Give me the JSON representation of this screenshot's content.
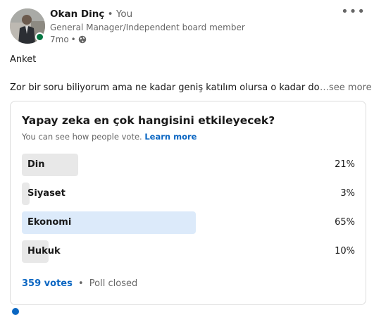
{
  "author": {
    "name": "Okan Dinç",
    "degree": "• You",
    "headline": "General Manager/Independent board member",
    "time": "7mo",
    "visibility_icon": "globe-icon",
    "presence_color": "#057642"
  },
  "post": {
    "line1": "Anket",
    "line2": "Zor bir soru biliyorum ama ne kadar geniş katılım olursa o kadar doğru",
    "see_more": "…see more"
  },
  "poll": {
    "question": "Yapay zeka en çok hangisini etkileyecek?",
    "note": "You can see how people vote.",
    "learn_more": "Learn more",
    "options": [
      {
        "label": "Din",
        "percent_text": "21%",
        "percent": 21,
        "highlight": false
      },
      {
        "label": "Siyaset",
        "percent_text": "3%",
        "percent": 3,
        "highlight": false
      },
      {
        "label": "Ekonomi",
        "percent_text": "65%",
        "percent": 65,
        "highlight": true
      },
      {
        "label": "Hukuk",
        "percent_text": "10%",
        "percent": 10,
        "highlight": false
      }
    ],
    "votes": "359 votes",
    "separator": "•",
    "status": "Poll closed"
  },
  "colors": {
    "bar": "#e8e8e8",
    "bar_selected": "#dceafa",
    "link": "#0a66c2"
  }
}
